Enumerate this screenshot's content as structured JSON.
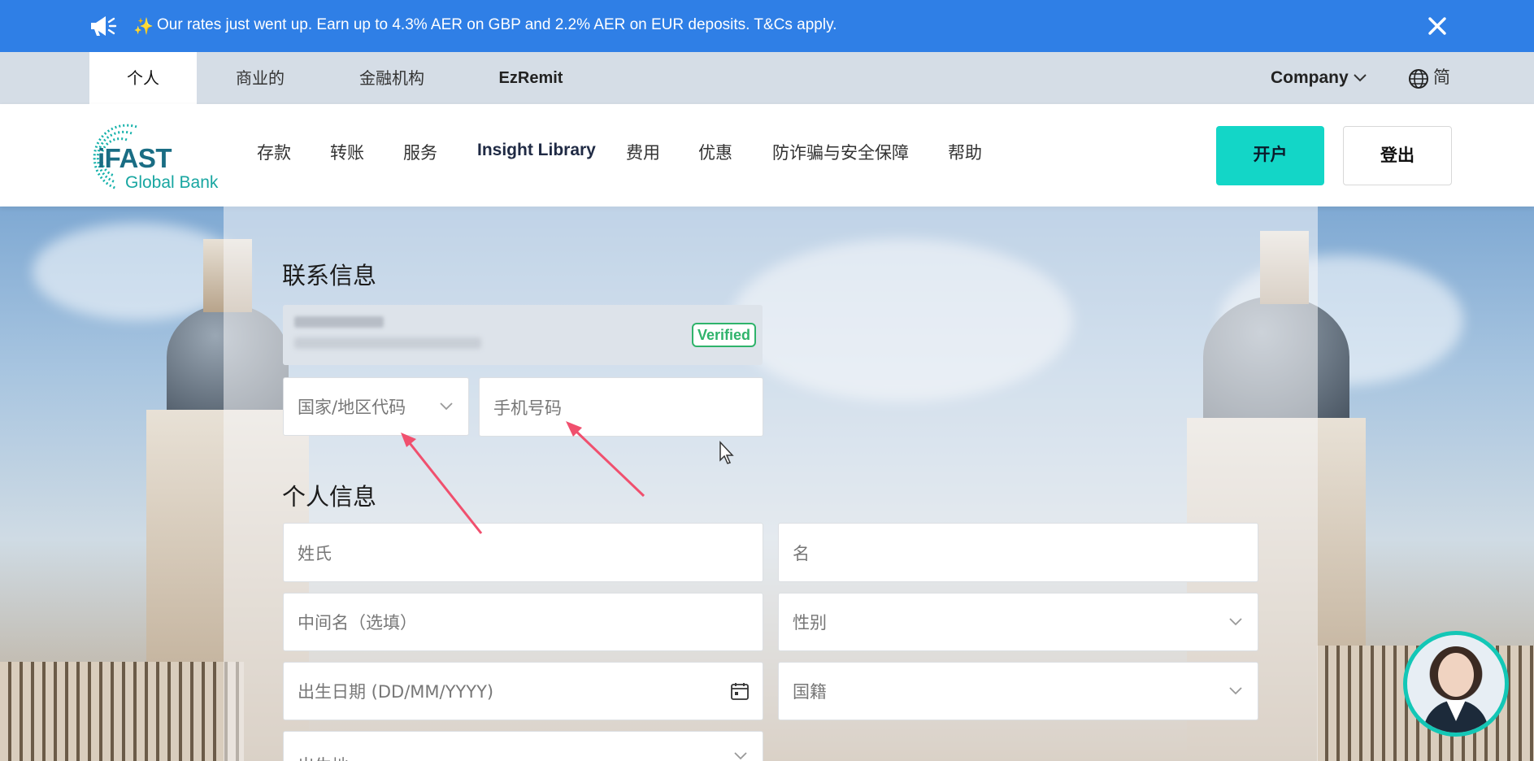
{
  "banner": {
    "sparkle": "✨",
    "message": "Our rates just went up. Earn up to 4.3% AER on GBP and 2.2% AER on EUR deposits. T&Cs apply."
  },
  "segments": {
    "items": [
      "个人",
      "商业的",
      "金融机构",
      "EzRemit"
    ],
    "active": "个人",
    "company_label": "Company",
    "language_label": "简"
  },
  "nav": {
    "logo_brand": "iFAST",
    "logo_sub": "Global Bank",
    "items": [
      "存款",
      "转账",
      "服务",
      "Insight Library",
      "费用",
      "优惠",
      "防诈骗与安全保障",
      "帮助"
    ],
    "open_account_label": "开户",
    "logout_label": "登出"
  },
  "form": {
    "contact_title": "联系信息",
    "verified_label": "Verified",
    "country_code_placeholder": "国家/地区代码",
    "mobile_placeholder": "手机号码",
    "personal_title": "个人信息",
    "surname_placeholder": "姓氏",
    "given_name_placeholder": "名",
    "middle_name_placeholder": "中间名（选填）",
    "gender_placeholder": "性别",
    "dob_placeholder": "出生日期 (DD/MM/YYYY)",
    "nationality_placeholder": "国籍",
    "birthplace_placeholder": "出生地"
  },
  "colors": {
    "banner": "#2f7fe6",
    "accent": "#13d6c7",
    "verified": "#2fb36b",
    "arrow": "#f0506e"
  },
  "icons": {
    "megaphone": "megaphone-icon",
    "close": "close-icon",
    "globe": "globe-icon",
    "chevron": "chevron-down-icon",
    "calendar": "calendar-icon"
  }
}
